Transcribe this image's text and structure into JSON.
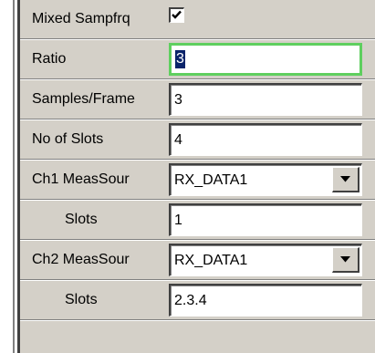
{
  "rows": {
    "mixed_sampfrq": {
      "label": "Mixed Sampfrq",
      "checked": true
    },
    "ratio": {
      "label": "Ratio",
      "value": "3"
    },
    "samples_frame": {
      "label": "Samples/Frame",
      "value": "3"
    },
    "no_of_slots": {
      "label": "No of Slots",
      "value": "4"
    },
    "ch1_meassour": {
      "label": "Ch1 MeasSour",
      "value": "RX_DATA1"
    },
    "ch1_slots": {
      "label": "Slots",
      "value": "1"
    },
    "ch2_meassour": {
      "label": "Ch2 MeasSour",
      "value": "RX_DATA1"
    },
    "ch2_slots": {
      "label": "Slots",
      "value": "2.3.4"
    }
  },
  "icons": {
    "checkmark": "checkmark-icon",
    "dropdown": "chevron-down-icon"
  },
  "colors": {
    "panel": "#d4d0c8",
    "focus_border": "#5fcf5f",
    "selection": "#0a246a"
  }
}
